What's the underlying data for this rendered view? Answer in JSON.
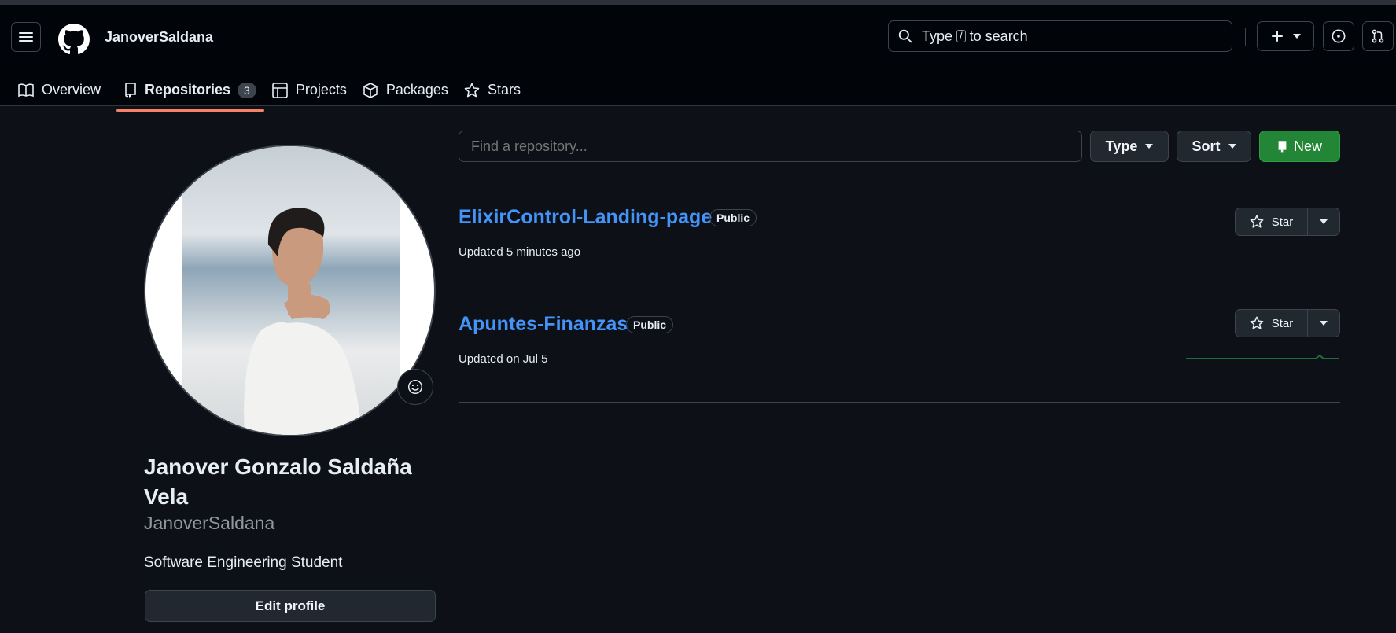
{
  "header": {
    "username": "JanoverSaldana",
    "search_prefix": "Type",
    "search_key": "/",
    "search_suffix": "to search"
  },
  "tabs": [
    {
      "label": "Overview",
      "icon": "book-icon"
    },
    {
      "label": "Repositories",
      "icon": "repo-icon",
      "count": "3",
      "active": true
    },
    {
      "label": "Projects",
      "icon": "table-icon"
    },
    {
      "label": "Packages",
      "icon": "package-icon"
    },
    {
      "label": "Stars",
      "icon": "star-icon"
    }
  ],
  "profile": {
    "full_name": "Janover Gonzalo Saldaña Vela",
    "login": "JanoverSaldana",
    "bio": "Software Engineering Student",
    "edit_label": "Edit profile"
  },
  "filters": {
    "find_placeholder": "Find a repository...",
    "type_label": "Type",
    "sort_label": "Sort",
    "new_label": "New"
  },
  "repos": [
    {
      "name": "ElixirControl-Landing-page",
      "visibility": "Public",
      "updated": "Updated 5 minutes ago",
      "star_label": "Star"
    },
    {
      "name": "Apuntes-Finanzas",
      "visibility": "Public",
      "updated": "Updated on Jul 5",
      "star_label": "Star"
    }
  ],
  "colors": {
    "background": "#0d1117",
    "header": "#010409",
    "link": "#4493f8",
    "primary_button": "#238636",
    "active_tab_underline": "#f78166"
  }
}
